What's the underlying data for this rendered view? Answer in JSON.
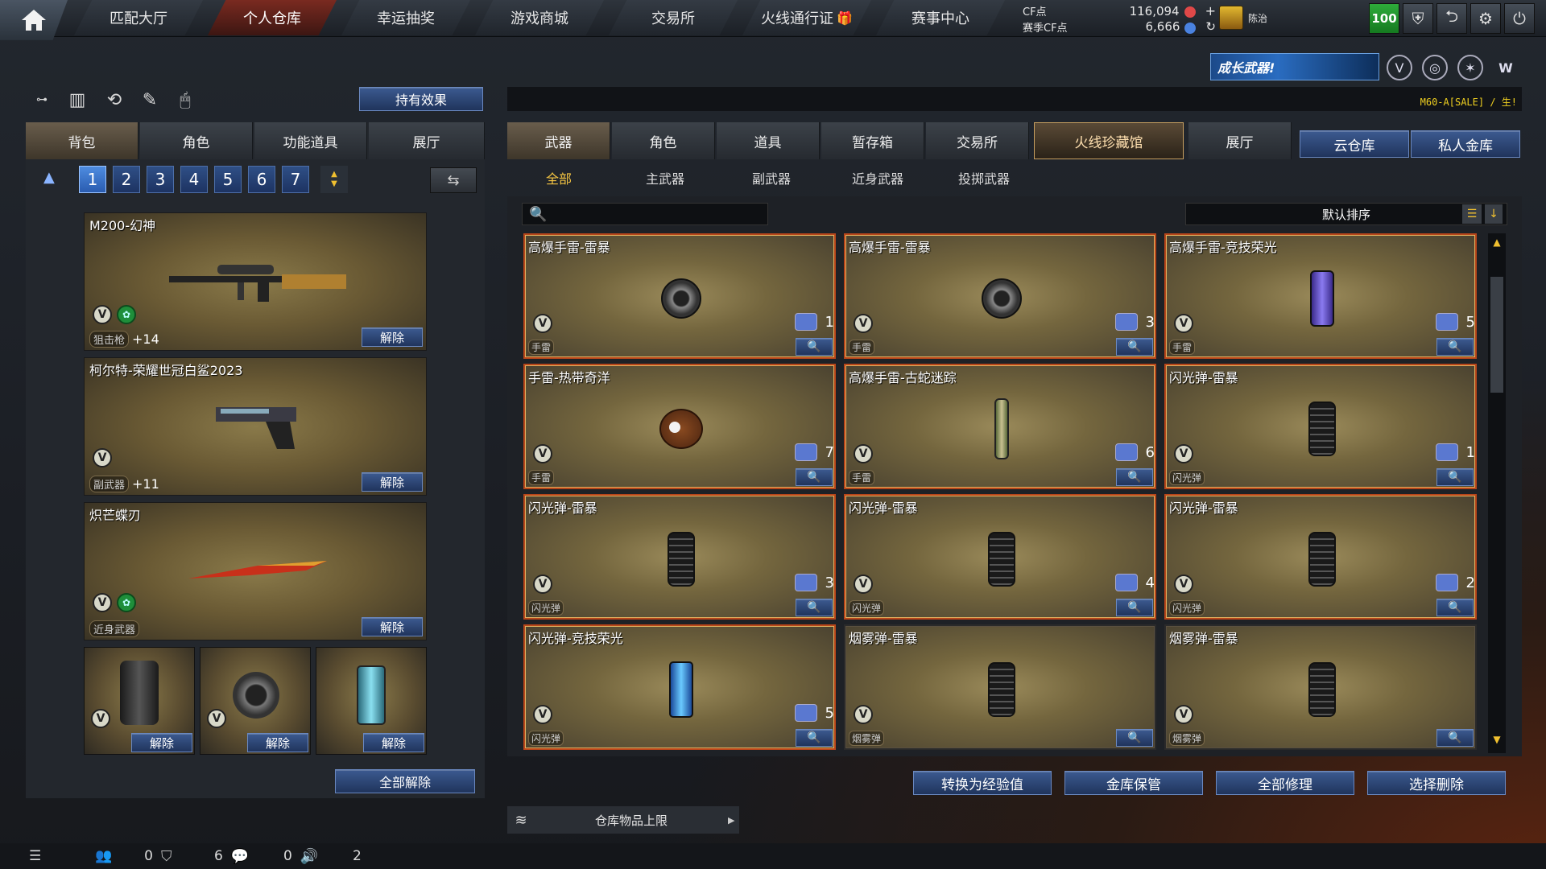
{
  "nav": {
    "tabs": [
      "匹配大厅",
      "个人仓库",
      "幸运抽奖",
      "游戏商城",
      "交易所",
      "火线通行证",
      "赛事中心"
    ],
    "active_index": 1,
    "cf_label": "CF点",
    "cf_value": "116,094",
    "season_cf_label": "赛季CF点",
    "season_cf_value": "6,666",
    "rank_name": "陈治",
    "level": "100"
  },
  "banner": {
    "text": "成长武器!"
  },
  "ticker": {
    "text": "M60-A[SALE] / 生!"
  },
  "effect_button": "持有效果",
  "left": {
    "tabs": [
      "背包",
      "角色",
      "功能道具",
      "展厅"
    ],
    "active_tab": 0,
    "pages": [
      "1",
      "2",
      "3",
      "4",
      "5",
      "6",
      "7"
    ],
    "active_page": 0,
    "equipped": [
      {
        "name": "M200-幻神",
        "category": "狙击枪",
        "plus": "+14",
        "unequip": "解除"
      },
      {
        "name": "柯尔特-荣耀世冠白鲨2023",
        "category": "副武器",
        "plus": "+11",
        "unequip": "解除"
      },
      {
        "name": "炽芒蝶刃",
        "category": "近身武器",
        "plus": "",
        "unequip": "解除"
      }
    ],
    "slots": [
      "解除",
      "解除",
      "解除"
    ],
    "unequip_all": "全部解除"
  },
  "right": {
    "tabs": [
      "武器",
      "角色",
      "道具",
      "暂存箱",
      "交易所",
      "火线珍藏馆",
      "展厅"
    ],
    "active_tab": 0,
    "storage_buttons": [
      "云仓库",
      "私人金库"
    ],
    "subtabs": [
      "全部",
      "主武器",
      "副武器",
      "近身武器",
      "投掷武器"
    ],
    "active_subtab": 0,
    "sort_label": "默认排序",
    "items": [
      {
        "name": "高爆手雷-雷暴",
        "type": "手雷",
        "count": "1",
        "icon": "grenade-round"
      },
      {
        "name": "高爆手雷-雷暴",
        "type": "手雷",
        "count": "3",
        "icon": "grenade-round"
      },
      {
        "name": "高爆手雷-竞技荣光",
        "type": "手雷",
        "count": "5",
        "icon": "grenade-can-purple"
      },
      {
        "name": "手雷-热带奇洋",
        "type": "手雷",
        "count": "7",
        "icon": "coconut"
      },
      {
        "name": "高爆手雷-古蛇迷踪",
        "type": "手雷",
        "count": "6",
        "icon": "grenade-stick"
      },
      {
        "name": "闪光弹-雷暴",
        "type": "闪光弹",
        "count": "1",
        "icon": "grenade-flash"
      },
      {
        "name": "闪光弹-雷暴",
        "type": "闪光弹",
        "count": "3",
        "icon": "grenade-flash"
      },
      {
        "name": "闪光弹-雷暴",
        "type": "闪光弹",
        "count": "4",
        "icon": "grenade-flash"
      },
      {
        "name": "闪光弹-雷暴",
        "type": "闪光弹",
        "count": "2",
        "icon": "grenade-flash"
      },
      {
        "name": "闪光弹-竞技荣光",
        "type": "闪光弹",
        "count": "5",
        "icon": "grenade-can-blue"
      },
      {
        "name": "烟雾弹-雷暴",
        "type": "烟雾弹",
        "count": "",
        "icon": "grenade-flash"
      },
      {
        "name": "烟雾弹-雷暴",
        "type": "烟雾弹",
        "count": "",
        "icon": "grenade-flash"
      }
    ],
    "actions": [
      "转换为经验值",
      "金库保管",
      "全部修理",
      "选择删除"
    ],
    "limit_label": "仓库物品上限"
  },
  "bottom": {
    "stats": [
      "0",
      "6",
      "0",
      "2"
    ]
  },
  "colors": {
    "accent_gold": "#f0c030",
    "button_blue": "#2a4577",
    "card_border": "#b8461a"
  }
}
